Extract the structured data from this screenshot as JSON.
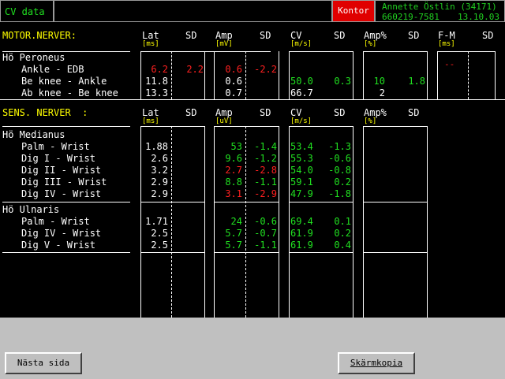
{
  "header": {
    "title": "CV data",
    "mode_button": "Kontor",
    "patient_name": "Annette Östlin (34171)",
    "patient_id": "660219-7581",
    "date": "13.10.03"
  },
  "motor": {
    "title": "MOTOR.NERVER:",
    "cols": [
      {
        "label": "Lat",
        "unit": "[ms]"
      },
      {
        "label": "SD",
        "unit": ""
      },
      {
        "label": "Amp",
        "unit": "[mV]"
      },
      {
        "label": "SD",
        "unit": ""
      },
      {
        "label": "CV",
        "unit": "[m/s]"
      },
      {
        "label": "SD",
        "unit": ""
      },
      {
        "label": "Amp%",
        "unit": "[%]"
      },
      {
        "label": "SD",
        "unit": ""
      },
      {
        "label": "F-M",
        "unit": "[ms]"
      },
      {
        "label": "SD",
        "unit": ""
      }
    ],
    "group": "Hö Peroneus",
    "rows": [
      {
        "name": "Ankle - EDB",
        "lat": "6.2",
        "lat_sd": "2.2",
        "amp": "0.6",
        "amp_sd": "-2.2",
        "cv": "",
        "cv_sd": "",
        "ampp": "",
        "ampp_sd": "",
        "fm": "--"
      },
      {
        "name": "Be knee - Ankle",
        "lat": "11.8",
        "lat_sd": "",
        "amp": "0.6",
        "amp_sd": "",
        "cv": "50.0",
        "cv_sd": "0.3",
        "ampp": "10",
        "ampp_sd": "1.8",
        "fm": ""
      },
      {
        "name": "Ab knee - Be knee",
        "lat": "13.3",
        "lat_sd": "",
        "amp": "0.7",
        "amp_sd": "",
        "cv": "66.7",
        "cv_sd": "",
        "ampp": "2",
        "ampp_sd": "",
        "fm": ""
      }
    ]
  },
  "sensory": {
    "title": "SENS. NERVER  :",
    "cols": [
      {
        "label": "Lat",
        "unit": "[ms]"
      },
      {
        "label": "SD",
        "unit": ""
      },
      {
        "label": "Amp",
        "unit": "[uV]"
      },
      {
        "label": "SD",
        "unit": ""
      },
      {
        "label": "CV",
        "unit": "[m/s]"
      },
      {
        "label": "SD",
        "unit": ""
      },
      {
        "label": "Amp%",
        "unit": "[%]"
      },
      {
        "label": "SD",
        "unit": ""
      }
    ],
    "group1": "Hö Medianus",
    "rows1": [
      {
        "name": "Palm - Wrist",
        "lat": "1.88",
        "amp": "53",
        "amp_sd": "-1.4",
        "cv": "53.4",
        "cv_sd": "-1.3"
      },
      {
        "name": "Dig I - Wrist",
        "lat": "2.6",
        "amp": "9.6",
        "amp_sd": "-1.2",
        "cv": "55.3",
        "cv_sd": "-0.6"
      },
      {
        "name": "Dig II - Wrist",
        "lat": "3.2",
        "amp": "2.7",
        "amp_sd": "-2.8",
        "cv": "54.0",
        "cv_sd": "-0.8"
      },
      {
        "name": "Dig III - Wrist",
        "lat": "2.9",
        "amp": "8.8",
        "amp_sd": "-1.1",
        "cv": "59.1",
        "cv_sd": "0.2"
      },
      {
        "name": "Dig IV - Wrist",
        "lat": "2.9",
        "amp": "3.1",
        "amp_sd": "-2.9",
        "cv": "47.9",
        "cv_sd": "-1.8"
      }
    ],
    "group2": "Hö Ulnaris",
    "rows2": [
      {
        "name": "Palm - Wrist",
        "lat": "1.71",
        "amp": "24",
        "amp_sd": "-0.6",
        "cv": "69.4",
        "cv_sd": "0.1"
      },
      {
        "name": "Dig IV - Wrist",
        "lat": "2.5",
        "amp": "5.7",
        "amp_sd": "-0.7",
        "cv": "61.9",
        "cv_sd": "0.2"
      },
      {
        "name": "Dig V - Wrist",
        "lat": "2.5",
        "amp": "5.7",
        "amp_sd": "-1.1",
        "cv": "61.9",
        "cv_sd": "0.4"
      }
    ]
  },
  "footer": {
    "next_page": "Nästa sida",
    "screenshot": "Skärmkopia"
  },
  "colors": {
    "normal": "#ffffff",
    "ok": "#20e020",
    "abnormal": "#ff2020",
    "heading": "#ffff00",
    "mode": "#e00000"
  }
}
